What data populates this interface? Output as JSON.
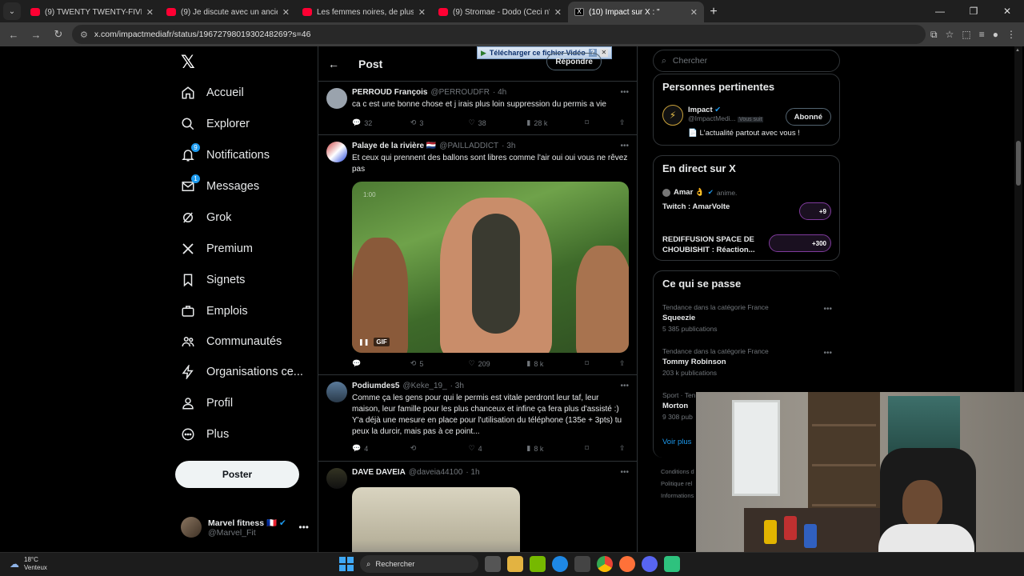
{
  "browser": {
    "tabs": [
      {
        "title": "(9) TWENTY TWENTY-FIVE ⭐",
        "active": false
      },
      {
        "title": "(9) Je discute avec un ancien de",
        "active": false
      },
      {
        "title": "Les femmes noires, de plus en",
        "active": false
      },
      {
        "title": "(9) Stromae - Dodo (Ceci n'est",
        "active": false
      },
      {
        "title": "(10) Impact sur X : \"",
        "active": true
      }
    ],
    "url": "x.com/impactmediafr/status/1967279801930248269?s=46"
  },
  "nav": {
    "items": [
      {
        "label": "Accueil",
        "icon": "home-icon"
      },
      {
        "label": "Explorer",
        "icon": "search-icon"
      },
      {
        "label": "Notifications",
        "icon": "bell-icon",
        "badge": "9"
      },
      {
        "label": "Messages",
        "icon": "mail-icon",
        "badge": "1"
      },
      {
        "label": "Grok",
        "icon": "grok-icon"
      },
      {
        "label": "Premium",
        "icon": "x-icon"
      },
      {
        "label": "Signets",
        "icon": "bookmark-icon"
      },
      {
        "label": "Emplois",
        "icon": "briefcase-icon"
      },
      {
        "label": "Communautés",
        "icon": "people-icon"
      },
      {
        "label": "Organisations ce...",
        "icon": "lightning-icon"
      },
      {
        "label": "Profil",
        "icon": "user-icon"
      },
      {
        "label": "Plus",
        "icon": "more-circle-icon"
      }
    ],
    "post_button": "Poster",
    "account": {
      "name": "Marvel fitness 🇫🇷",
      "handle": "@Marvel_Fit"
    }
  },
  "center": {
    "title": "Post",
    "reply_button": "Répondre",
    "download_bar": "Télécharger ce fichier Vidéo",
    "tweets": [
      {
        "name": "PERROUD François",
        "handle": "@PERROUDFR",
        "time": "· 4h",
        "text": "ca  c est  une bonne chose et  j irais plus loin suppression du permis a vie",
        "replies": "32",
        "reposts": "3",
        "likes": "38",
        "views": "28 k"
      },
      {
        "name": "Palaye de la rivière 🇳🇱",
        "handle": "@PAILLADDICT",
        "time": "· 3h",
        "text": "Et ceux qui prennent des ballons sont libres comme l'air oui oui vous ne rêvez pas",
        "gif_label": "GIF",
        "gif_time": "1:00",
        "replies": "",
        "reposts": "5",
        "likes": "209",
        "views": "8 k"
      },
      {
        "name": "Podiumdes5",
        "handle": "@Keke_19_",
        "time": "· 3h",
        "text": "Comme ça les gens pour qui le permis est vitale perdront leur taf, leur maison, leur famille pour les plus chanceux et infine ça fera plus d'assisté :) Y'a déjà une mesure en place pour l'utilisation du téléphone (135e + 3pts) tu peux la durcir, mais pas à ce point...",
        "replies": "4",
        "reposts": "",
        "likes": "4",
        "views": "8 k"
      },
      {
        "name": "DAVE DAVEIA",
        "handle": "@daveia44100",
        "time": "· 1h",
        "text": ""
      }
    ]
  },
  "right": {
    "search_placeholder": "Chercher",
    "relevant": {
      "title": "Personnes pertinentes",
      "name": "Impact",
      "handle": "@ImpactMedi...",
      "follows_you": "Vous suit",
      "bio": "📄 L'actualité partout avec vous !",
      "button": "Abonné"
    },
    "live": {
      "title": "En direct sur X",
      "host": "Amar 👌",
      "host_action": "anime.",
      "item1": "Twitch : AmarVolte",
      "item1_count": "+9",
      "item2": "REDIFFUSION SPACE DE CHOUBISHIT : Réaction...",
      "item2_count": "+300"
    },
    "trends": {
      "title": "Ce qui se passe",
      "items": [
        {
          "context": "Tendance dans la catégorie France",
          "name": "Squeezie",
          "count": "5 385 publications"
        },
        {
          "context": "Tendance dans la catégorie France",
          "name": "Tommy Robinson",
          "count": "203 k publications"
        },
        {
          "context": "Sport · Ten",
          "name": "Morton",
          "count": "9 308 pub"
        }
      ],
      "show_more": "Voir plus"
    },
    "footer": [
      "Conditions d",
      "Politique rel",
      "Informations"
    ]
  },
  "taskbar": {
    "temp": "18°C",
    "weather": "Venteux",
    "search": "Rechercher"
  }
}
